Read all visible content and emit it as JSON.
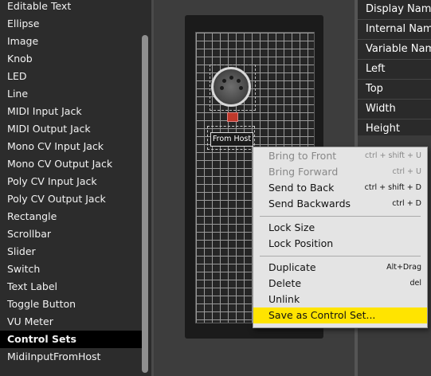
{
  "component_list": {
    "items": [
      "Editable Text",
      "Ellipse",
      "Image",
      "Knob",
      "LED",
      "Line",
      "MIDI Input Jack",
      "MIDI Output Jack",
      "Mono CV Input Jack",
      "Mono CV Output Jack",
      "Poly CV Input Jack",
      "Poly CV Output Jack",
      "Rectangle",
      "Scrollbar",
      "Slider",
      "Switch",
      "Text Label",
      "Toggle Button",
      "VU Meter"
    ],
    "section_header": "Control Sets",
    "section_items": [
      "MidiInputFromHost"
    ]
  },
  "canvas": {
    "text_label": "From Host"
  },
  "properties": {
    "rows": [
      "Display Name",
      "Internal Name",
      "Variable Name",
      "Left",
      "Top",
      "Width",
      "Height"
    ]
  },
  "context_menu": {
    "bring_to_front": {
      "label": "Bring to Front",
      "shortcut": "ctrl + shift + U"
    },
    "bring_forward": {
      "label": "Bring Forward",
      "shortcut": "ctrl + U"
    },
    "send_to_back": {
      "label": "Send to Back",
      "shortcut": "ctrl + shift + D"
    },
    "send_backwards": {
      "label": "Send Backwards",
      "shortcut": "ctrl + D"
    },
    "lock_size": {
      "label": "Lock Size"
    },
    "lock_position": {
      "label": "Lock Position"
    },
    "duplicate": {
      "label": "Duplicate",
      "shortcut": "Alt+Drag"
    },
    "delete": {
      "label": "Delete",
      "shortcut": "del"
    },
    "unlink": {
      "label": "Unlink"
    },
    "save_as_control_set": {
      "label": "Save as Control Set..."
    }
  },
  "colors": {
    "menu_highlight": "#ffe400",
    "led": "#c0392b"
  }
}
